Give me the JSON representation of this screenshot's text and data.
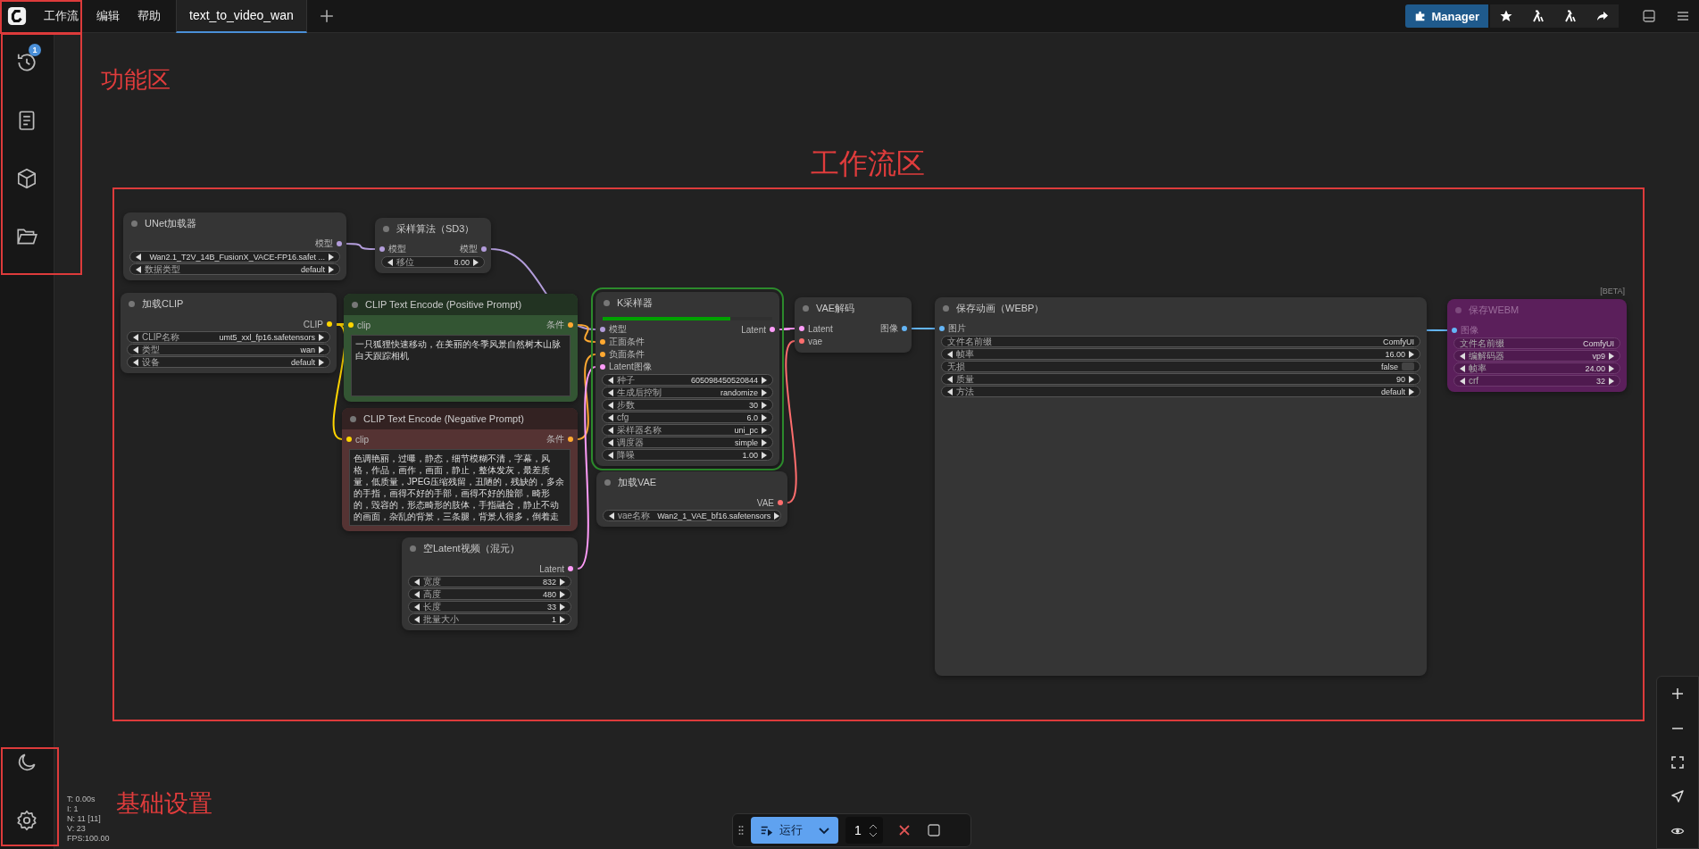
{
  "menu": [
    {
      "label": "工作流"
    },
    {
      "label": "编辑"
    },
    {
      "label": "帮助"
    }
  ],
  "tabs": [
    {
      "label": "text_to_video_wan",
      "selected": true
    }
  ],
  "manager": {
    "label": "Manager"
  },
  "sidebar": {
    "queue_badge": "1"
  },
  "nodes": [
    {
      "title": "UNet加载器",
      "kind": "default",
      "executing": false,
      "outputs": [
        {
          "label": "模型",
          "color": "#b39ddb"
        }
      ],
      "widgets": [
        {
          "kind": "combo",
          "value": "Wan2.1_T2V_14B_FusionX_VACE-FP16.safet ..."
        },
        {
          "kind": "combo",
          "label": "数据类型",
          "value": "default"
        }
      ]
    },
    {
      "title": "采样算法（SD3）",
      "kind": "default",
      "executing": false,
      "inputs": [
        {
          "label": "模型",
          "color": "#b39ddb"
        }
      ],
      "outputs": [
        {
          "label": "模型",
          "color": "#b39ddb"
        }
      ],
      "widgets": [
        {
          "kind": "number",
          "label": "移位",
          "value": "8.00"
        }
      ]
    },
    {
      "title": "加载CLIP",
      "kind": "default",
      "executing": false,
      "outputs": [
        {
          "label": "CLIP",
          "color": "#ffd500"
        }
      ],
      "widgets": [
        {
          "kind": "combo",
          "label": "CLIP名称",
          "value": "umt5_xxl_fp16.safetensors"
        },
        {
          "kind": "combo",
          "label": "类型",
          "value": "wan"
        },
        {
          "kind": "combo",
          "label": "设备",
          "value": "default"
        }
      ]
    },
    {
      "title": "CLIP Text Encode (Positive Prompt)",
      "kind": "positive",
      "executing": false,
      "inputs": [
        {
          "label": "clip",
          "color": "#ffd500"
        }
      ],
      "outputs": [
        {
          "label": "条件",
          "color": "#ffa931"
        }
      ],
      "text": "一只狐狸快速移动，在美丽的冬季风景自然树木山脉白天跟踪相机"
    },
    {
      "title": "CLIP Text Encode (Negative Prompt)",
      "kind": "negative",
      "executing": false,
      "inputs": [
        {
          "label": "clip",
          "color": "#ffd500"
        }
      ],
      "outputs": [
        {
          "label": "条件",
          "color": "#ffa931"
        }
      ],
      "text": "色调艳丽，过曝，静态，细节模糊不清，字幕，风格，作品，画作，画面，静止，整体发灰，最差质量，低质量，JPEG压缩残留，丑陋的，残缺的，多余的手指，画得不好的手部，画得不好的脸部，畸形的，毁容的，形态畸形的肢体，手指融合，静止不动的画面，杂乱的背景，三条腿，背景人很多，倒着走"
    },
    {
      "title": "空Latent视频（混元）",
      "kind": "default",
      "executing": false,
      "outputs": [
        {
          "label": "Latent",
          "color": "#ff9cf9"
        }
      ],
      "widgets": [
        {
          "kind": "number",
          "label": "宽度",
          "value": "832"
        },
        {
          "kind": "number",
          "label": "高度",
          "value": "480"
        },
        {
          "kind": "number",
          "label": "长度",
          "value": "33"
        },
        {
          "kind": "number",
          "label": "批量大小",
          "value": "1"
        }
      ]
    },
    {
      "title": "K采样器",
      "kind": "default",
      "executing": true,
      "level": 0.75,
      "inputs": [
        {
          "label": "模型",
          "color": "#b39ddb"
        },
        {
          "label": "正面条件",
          "color": "#ffa931"
        },
        {
          "label": "负面条件",
          "color": "#ffa931"
        },
        {
          "label": "Latent图像",
          "color": "#ff9cf9"
        }
      ],
      "outputs": [
        {
          "label": "Latent",
          "color": "#ff9cf9"
        }
      ],
      "widgets": [
        {
          "kind": "number",
          "label": "种子",
          "value": "605098450520844"
        },
        {
          "kind": "combo",
          "label": "生成后控制",
          "value": "randomize"
        },
        {
          "kind": "number",
          "label": "步数",
          "value": "30"
        },
        {
          "kind": "number",
          "label": "cfg",
          "value": "6.0"
        },
        {
          "kind": "combo",
          "label": "采样器名称",
          "value": "uni_pc"
        },
        {
          "kind": "combo",
          "label": "调度器",
          "value": "simple"
        },
        {
          "kind": "number",
          "label": "降噪",
          "value": "1.00"
        }
      ]
    },
    {
      "title": "加载VAE",
      "kind": "default",
      "executing": false,
      "outputs": [
        {
          "label": "VAE",
          "color": "#ff6e6e"
        }
      ],
      "widgets": [
        {
          "kind": "combo",
          "label": "vae名称",
          "value": "Wan2_1_VAE_bf16.safetensors"
        }
      ]
    },
    {
      "title": "VAE解码",
      "kind": "default",
      "executing": false,
      "inputs": [
        {
          "label": "Latent",
          "color": "#ff9cf9"
        },
        {
          "label": "vae",
          "color": "#ff6e6e"
        }
      ],
      "outputs": [
        {
          "label": "图像",
          "color": "#64b5f6"
        }
      ]
    },
    {
      "title": "保存动画（WEBP）",
      "kind": "default",
      "executing": false,
      "inputs": [
        {
          "label": "图片",
          "color": "#64b5f6"
        }
      ],
      "widgets": [
        {
          "kind": "text",
          "label": "文件名前缀",
          "value": "ComfyUI"
        },
        {
          "kind": "number",
          "label": "帧率",
          "value": "16.00"
        },
        {
          "kind": "toggle",
          "label": "无损",
          "value": "false",
          "on": false
        },
        {
          "kind": "number",
          "label": "质量",
          "value": "90"
        },
        {
          "kind": "combo",
          "label": "方法",
          "value": "default"
        }
      ]
    },
    {
      "title": "保存WEBM",
      "kind": "bypass",
      "executing": false,
      "badge": "[BETA]",
      "inputs": [
        {
          "label": "图像",
          "color": "#64b5f6"
        }
      ],
      "widgets": [
        {
          "kind": "text",
          "label": "文件名前缀",
          "value": "ComfyUI"
        },
        {
          "kind": "combo",
          "label": "编解码器",
          "value": "vp9"
        },
        {
          "kind": "number",
          "label": "帧率",
          "value": "24.00"
        },
        {
          "kind": "number",
          "label": "crf",
          "value": "32"
        }
      ]
    }
  ],
  "stats": [
    "T: 0.00s",
    "I: 1",
    "N: 11 [11]",
    "V: 23",
    "FPS:100.00"
  ],
  "run": {
    "label": "运行",
    "count": "1"
  },
  "annotations": [
    {
      "label": "功能区"
    },
    {
      "label": "工作流区"
    },
    {
      "label": "基础设置"
    }
  ]
}
